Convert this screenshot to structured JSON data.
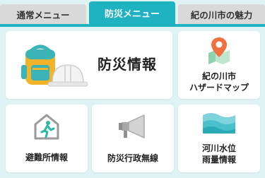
{
  "tabs": {
    "normal": "通常メニュー",
    "bousai": "防災メニュー",
    "miryoku": "紀の川市の魅力"
  },
  "cards": {
    "info": "防災情報",
    "hazard_line1": "紀の川市",
    "hazard_line2": "ハザードマップ",
    "evac": "避難所情報",
    "radio": "防災行政無線",
    "river_line1": "河川水位",
    "river_line2": "雨量情報"
  },
  "colors": {
    "accent": "#1fb2c1",
    "background": "#dff3f5",
    "tab_inactive": "#d9d9d9"
  },
  "icons": {
    "info": "backpack-helmet-icon",
    "hazard": "map-pin-icon",
    "evac": "evacuation-shelter-icon",
    "radio": "megaphone-icon",
    "river": "water-wave-icon"
  }
}
